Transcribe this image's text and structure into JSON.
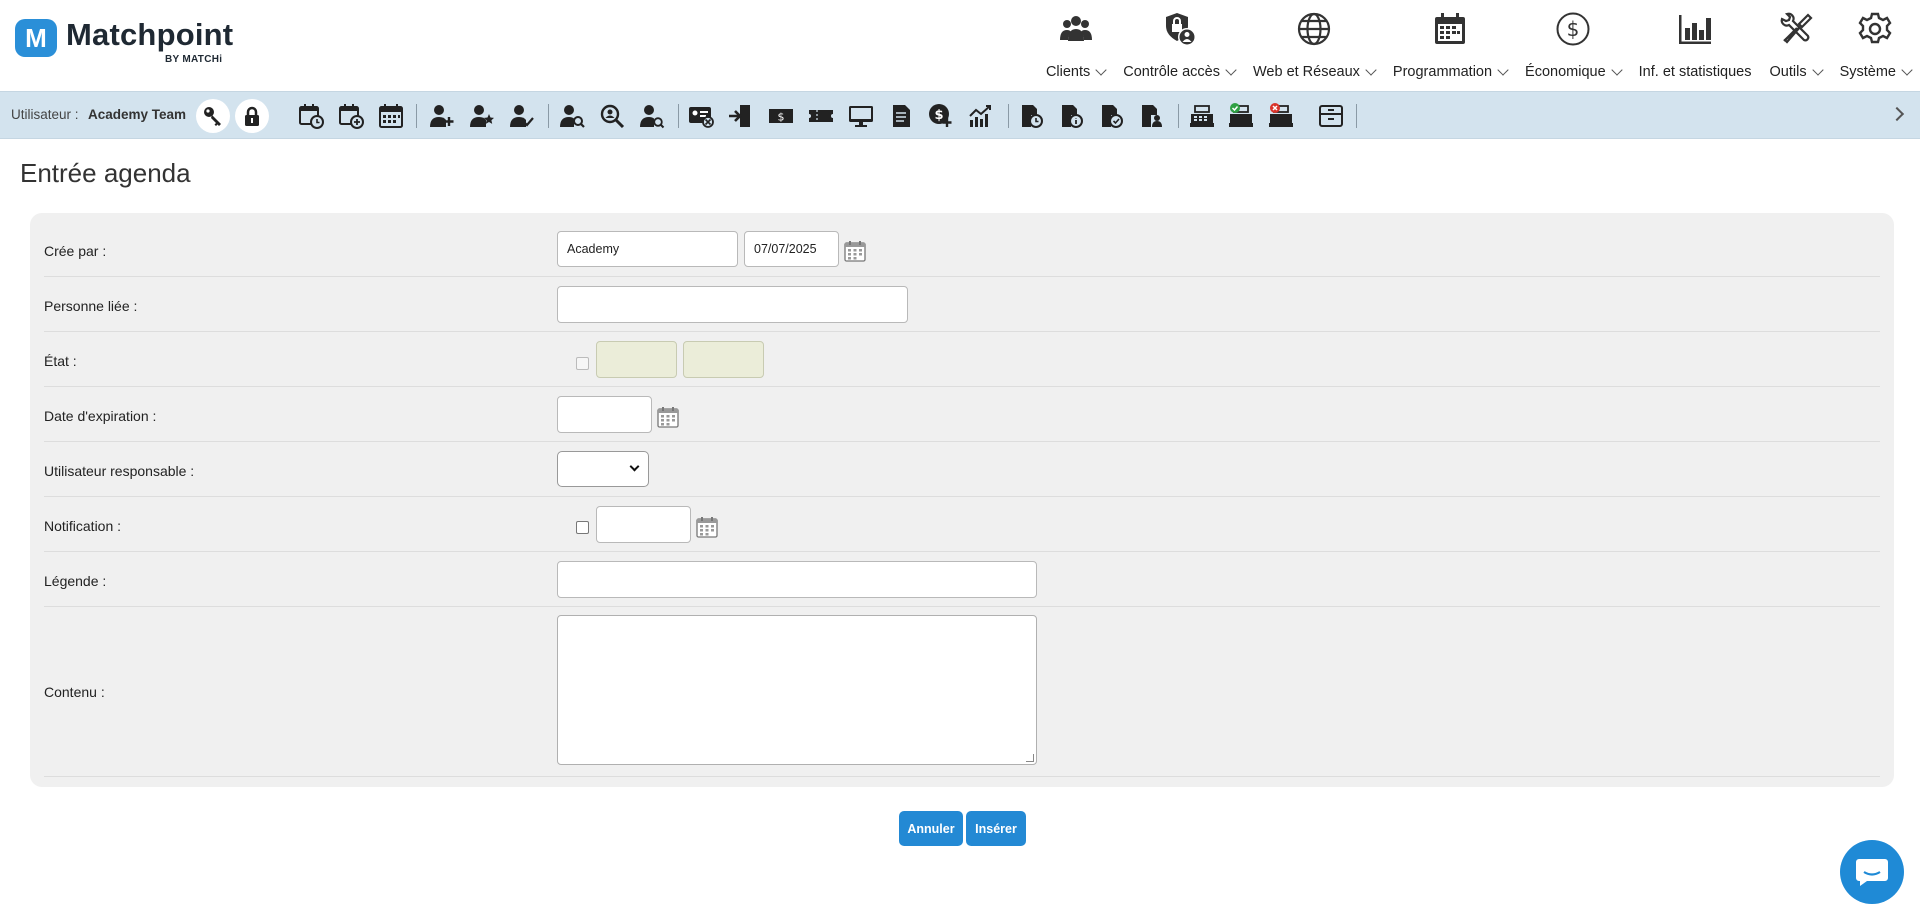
{
  "brand": {
    "name": "Matchpoint",
    "sub": "BY MATCHi",
    "badge": "M",
    "color": "#2a8fd8"
  },
  "nav": [
    {
      "label": "Clients",
      "icon": "users-group-icon",
      "dropdown": true
    },
    {
      "label": "Contrôle accès",
      "icon": "access-lock-icon",
      "dropdown": true
    },
    {
      "label": "Web et Réseaux",
      "icon": "globe-icon",
      "dropdown": true
    },
    {
      "label": "Programmation",
      "icon": "calendar-icon",
      "dropdown": true
    },
    {
      "label": "Économique",
      "icon": "dollar-circle-icon",
      "dropdown": true
    },
    {
      "label": "Inf. et statistiques",
      "icon": "bar-chart-icon",
      "dropdown": false
    },
    {
      "label": "Outils",
      "icon": "tools-icon",
      "dropdown": true
    },
    {
      "label": "Système",
      "icon": "gear-icon",
      "dropdown": true
    }
  ],
  "toolbar": {
    "user_label": "Utilisateur :",
    "user_name": "Academy Team"
  },
  "page": {
    "title": "Entrée agenda"
  },
  "form": {
    "created_by": {
      "label": "Crée par :",
      "value": "Academy",
      "date": "07/07/2025"
    },
    "linked_person": {
      "label": "Personne liée :",
      "value": ""
    },
    "status": {
      "label": "État :"
    },
    "expiration": {
      "label": "Date d'expiration :",
      "value": ""
    },
    "responsible": {
      "label": "Utilisateur responsable :",
      "value": ""
    },
    "notification": {
      "label": "Notification :",
      "value": ""
    },
    "caption": {
      "label": "Légende :",
      "value": ""
    },
    "content": {
      "label": "Contenu :",
      "value": ""
    }
  },
  "actions": {
    "cancel": "Annuler",
    "insert": "Insérer"
  },
  "colors": {
    "accent": "#2389d4",
    "toolbar_bg": "#d3e3ee",
    "panel_bg": "#f0f0f0"
  }
}
